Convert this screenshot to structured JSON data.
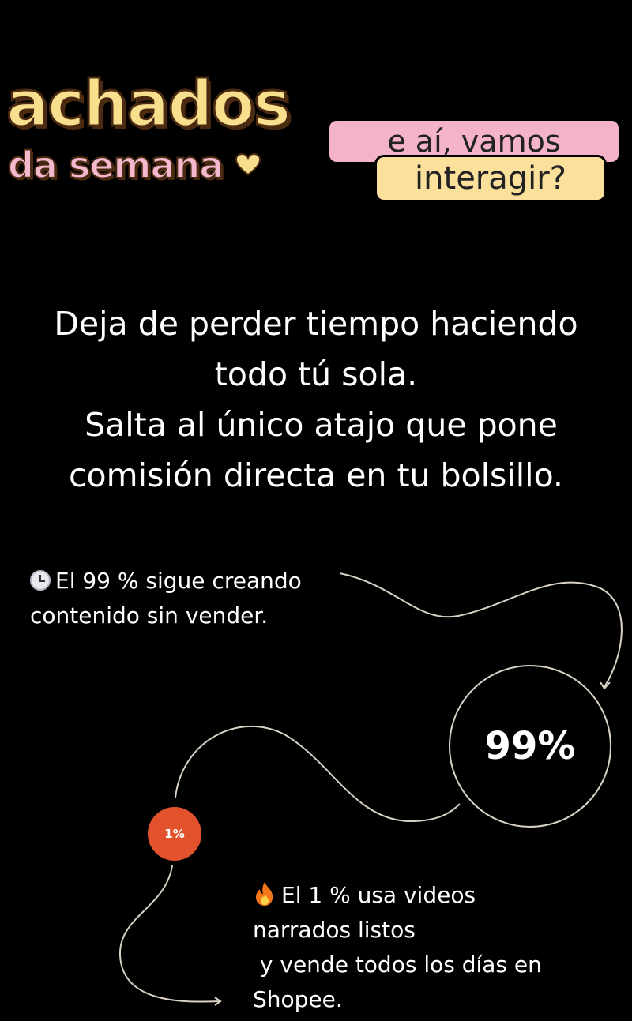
{
  "logo": {
    "line1": "achados",
    "line2": "da semana",
    "heart": "heart-icon"
  },
  "badges": {
    "top": "e aí, vamos",
    "bottom": "interagir?",
    "top_color": "#f4b3c8",
    "bottom_color": "#fbe09c"
  },
  "headline": {
    "lines": [
      "Deja de perder tiempo haciendo",
      "todo tú sola.",
      " Salta al único atajo que pone",
      "comisión directa en tu bolsillo."
    ]
  },
  "stat_99": {
    "icon": "clock-icon",
    "lines": [
      "El 99 % sigue creando",
      "contenido sin vender."
    ],
    "value": "99%"
  },
  "stat_1": {
    "icon": "fire-icon",
    "lines": [
      "El 1 % usa videos",
      "narrados listos",
      " y vende todos los días en",
      "Shopee."
    ],
    "value": "1%",
    "color": "#e2532d"
  }
}
